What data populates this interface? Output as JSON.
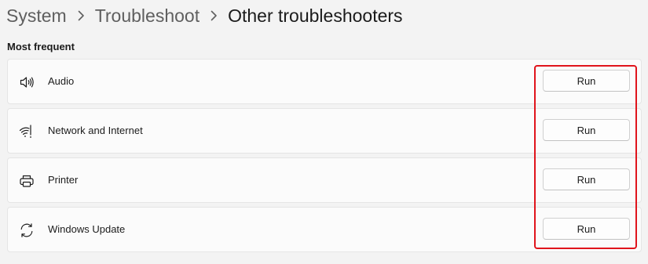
{
  "breadcrumb": {
    "items": [
      {
        "label": "System"
      },
      {
        "label": "Troubleshoot"
      },
      {
        "label": "Other troubleshooters"
      }
    ]
  },
  "section": {
    "title": "Most frequent"
  },
  "troubleshooters": [
    {
      "label": "Audio",
      "icon": "speaker-icon",
      "button": "Run"
    },
    {
      "label": "Network and Internet",
      "icon": "wifi-icon",
      "button": "Run"
    },
    {
      "label": "Printer",
      "icon": "printer-icon",
      "button": "Run"
    },
    {
      "label": "Windows Update",
      "icon": "refresh-icon",
      "button": "Run"
    }
  ],
  "colors": {
    "highlight": "#e0141c",
    "background": "#f3f3f3",
    "card": "#fbfbfb"
  }
}
